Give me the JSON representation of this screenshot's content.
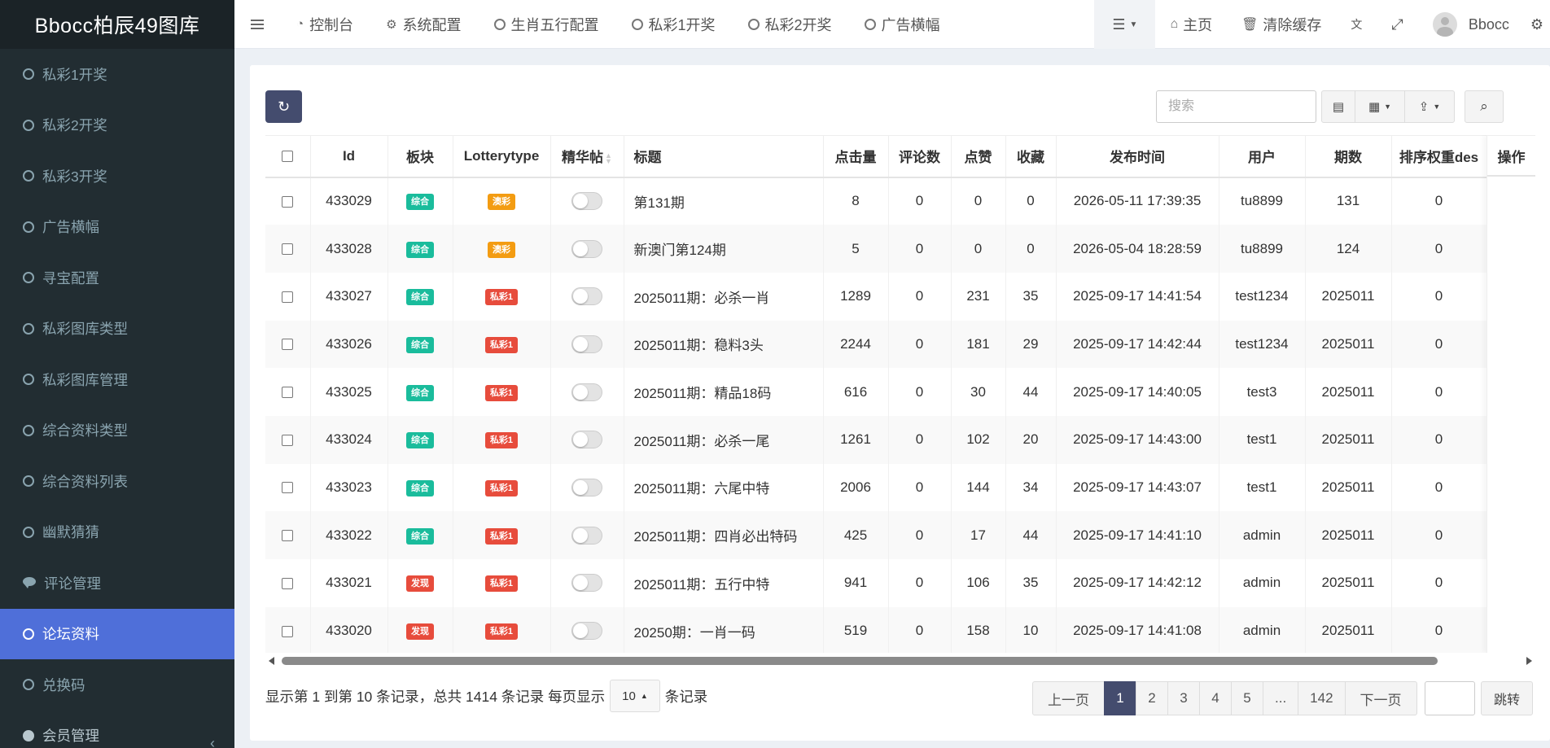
{
  "app": {
    "title": "Bbocc柏辰49图库"
  },
  "sidebar": {
    "items": [
      {
        "label": "私彩1开奖",
        "icon": "circle-icon"
      },
      {
        "label": "私彩2开奖",
        "icon": "circle-icon"
      },
      {
        "label": "私彩3开奖",
        "icon": "circle-icon"
      },
      {
        "label": "广告横幅",
        "icon": "circle-icon"
      },
      {
        "label": "寻宝配置",
        "icon": "circle-icon"
      },
      {
        "label": "私彩图库类型",
        "icon": "circle-icon"
      },
      {
        "label": "私彩图库管理",
        "icon": "circle-icon"
      },
      {
        "label": "综合资料类型",
        "icon": "circle-icon"
      },
      {
        "label": "综合资料列表",
        "icon": "circle-icon"
      },
      {
        "label": "幽默猜猜",
        "icon": "circle-icon"
      },
      {
        "label": "评论管理",
        "icon": "comments-icon"
      },
      {
        "label": "论坛资料",
        "icon": "circle-icon",
        "active": true
      },
      {
        "label": "兑换码",
        "icon": "circle-icon"
      },
      {
        "label": "会员管理",
        "icon": "user-circle-icon"
      }
    ]
  },
  "header": {
    "tabs": [
      {
        "label": "控制台",
        "icon": "dashboard-icon"
      },
      {
        "label": "系统配置",
        "icon": "gear-icon"
      },
      {
        "label": "生肖五行配置",
        "icon": "circle-icon"
      },
      {
        "label": "私彩1开奖",
        "icon": "circle-icon"
      },
      {
        "label": "私彩2开奖",
        "icon": "circle-icon"
      },
      {
        "label": "广告横幅",
        "icon": "circle-icon"
      }
    ],
    "home_label": "主页",
    "clear_cache_label": "清除缓存",
    "username": "Bbocc"
  },
  "toolbar": {
    "search_placeholder": "搜索"
  },
  "table": {
    "columns": [
      "Id",
      "板块",
      "Lotterytype",
      "精华帖",
      "标题",
      "点击量",
      "评论数",
      "点赞",
      "收藏",
      "发布时间",
      "用户",
      "期数",
      "排序权重des",
      "操作"
    ],
    "rows": [
      {
        "id": "433029",
        "board": "综合",
        "board_color": "#1abc9c",
        "lottery": "澳彩",
        "lottery_color": "#f39c12",
        "title": "第131期",
        "clicks": "8",
        "comments": "0",
        "likes": "0",
        "favs": "0",
        "time": "2026-05-11 17:39:35",
        "user": "tu8899",
        "issue": "131",
        "weight": "0"
      },
      {
        "id": "433028",
        "board": "综合",
        "board_color": "#1abc9c",
        "lottery": "澳彩",
        "lottery_color": "#f39c12",
        "title": "新澳门第124期",
        "clicks": "5",
        "comments": "0",
        "likes": "0",
        "favs": "0",
        "time": "2026-05-04 18:28:59",
        "user": "tu8899",
        "issue": "124",
        "weight": "0"
      },
      {
        "id": "433027",
        "board": "综合",
        "board_color": "#1abc9c",
        "lottery": "私彩1",
        "lottery_color": "#e74c3c",
        "title": "2025011期：必杀一肖",
        "clicks": "1289",
        "comments": "0",
        "likes": "231",
        "favs": "35",
        "time": "2025-09-17 14:41:54",
        "user": "test1234",
        "issue": "2025011",
        "weight": "0"
      },
      {
        "id": "433026",
        "board": "综合",
        "board_color": "#1abc9c",
        "lottery": "私彩1",
        "lottery_color": "#e74c3c",
        "title": "2025011期：稳料3头",
        "clicks": "2244",
        "comments": "0",
        "likes": "181",
        "favs": "29",
        "time": "2025-09-17 14:42:44",
        "user": "test1234",
        "issue": "2025011",
        "weight": "0"
      },
      {
        "id": "433025",
        "board": "综合",
        "board_color": "#1abc9c",
        "lottery": "私彩1",
        "lottery_color": "#e74c3c",
        "title": "2025011期：精品18码",
        "clicks": "616",
        "comments": "0",
        "likes": "30",
        "favs": "44",
        "time": "2025-09-17 14:40:05",
        "user": "test3",
        "issue": "2025011",
        "weight": "0"
      },
      {
        "id": "433024",
        "board": "综合",
        "board_color": "#1abc9c",
        "lottery": "私彩1",
        "lottery_color": "#e74c3c",
        "title": "2025011期：必杀一尾",
        "clicks": "1261",
        "comments": "0",
        "likes": "102",
        "favs": "20",
        "time": "2025-09-17 14:43:00",
        "user": "test1",
        "issue": "2025011",
        "weight": "0"
      },
      {
        "id": "433023",
        "board": "综合",
        "board_color": "#1abc9c",
        "lottery": "私彩1",
        "lottery_color": "#e74c3c",
        "title": "2025011期：六尾中特",
        "clicks": "2006",
        "comments": "0",
        "likes": "144",
        "favs": "34",
        "time": "2025-09-17 14:43:07",
        "user": "test1",
        "issue": "2025011",
        "weight": "0"
      },
      {
        "id": "433022",
        "board": "综合",
        "board_color": "#1abc9c",
        "lottery": "私彩1",
        "lottery_color": "#e74c3c",
        "title": "2025011期：四肖必出特码",
        "clicks": "425",
        "comments": "0",
        "likes": "17",
        "favs": "44",
        "time": "2025-09-17 14:41:10",
        "user": "admin",
        "issue": "2025011",
        "weight": "0"
      },
      {
        "id": "433021",
        "board": "发现",
        "board_color": "#e74c3c",
        "lottery": "私彩1",
        "lottery_color": "#e74c3c",
        "title": "2025011期：五行中特",
        "clicks": "941",
        "comments": "0",
        "likes": "106",
        "favs": "35",
        "time": "2025-09-17 14:42:12",
        "user": "admin",
        "issue": "2025011",
        "weight": "0"
      },
      {
        "id": "433020",
        "board": "发现",
        "board_color": "#e74c3c",
        "lottery": "私彩1",
        "lottery_color": "#e74c3c",
        "title": "20250期：一肖一码",
        "clicks": "519",
        "comments": "0",
        "likes": "158",
        "favs": "10",
        "time": "2025-09-17 14:41:08",
        "user": "admin",
        "issue": "2025011",
        "weight": "0"
      }
    ]
  },
  "footer": {
    "info_prefix": "显示第 1 到第 10 条记录，总共 1414 条记录 每页显示",
    "page_size": "10",
    "info_suffix": "条记录",
    "prev_label": "上一页",
    "next_label": "下一页",
    "pages": [
      "1",
      "2",
      "3",
      "4",
      "5",
      "...",
      "142"
    ],
    "active_page": "1",
    "jump_label": "跳转"
  },
  "colors": {
    "accent": "#444c6e",
    "sidebar_bg": "#222d32",
    "sidebar_active": "#4f6fd9"
  }
}
